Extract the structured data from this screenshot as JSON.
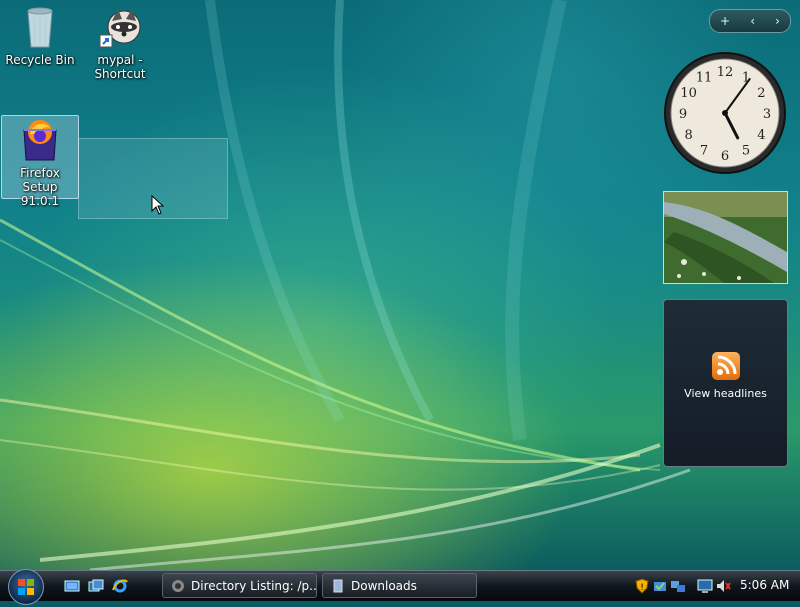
{
  "desktop": {
    "icons": [
      {
        "label": "Recycle Bin",
        "icon": "recycle-bin-icon"
      },
      {
        "label": "mypal - Shortcut",
        "icon": "mypal-raccoon-icon"
      },
      {
        "label": "Firefox Setup 91.0.1",
        "icon": "firefox-setup-icon",
        "selected": true
      }
    ]
  },
  "sidebar": {
    "add_glyph": "+",
    "prev_glyph": "‹",
    "next_glyph": "›",
    "clock": {
      "hour": 5,
      "minute": 6
    },
    "clock_numbers": [
      "12",
      "1",
      "2",
      "3",
      "4",
      "5",
      "6",
      "7",
      "8",
      "9",
      "10",
      "11"
    ],
    "feeds_label": "View headlines"
  },
  "taskbar": {
    "tasks": [
      {
        "label": "Directory Listing: /p...",
        "icon": "browser-window-icon"
      },
      {
        "label": "Downloads",
        "icon": "folder-icon"
      }
    ],
    "time": "5:06 AM",
    "quick_launch": [
      "show-desktop-icon",
      "switch-windows-icon",
      "internet-explorer-icon"
    ],
    "tray_icons": [
      "security-shield-icon",
      "network-check-icon",
      "network-icon",
      "display-icon",
      "volume-muted-icon"
    ]
  },
  "colors": {
    "taskbar": "#10161c",
    "accent": "#2a9a6a",
    "rss": "#e36c0a"
  }
}
